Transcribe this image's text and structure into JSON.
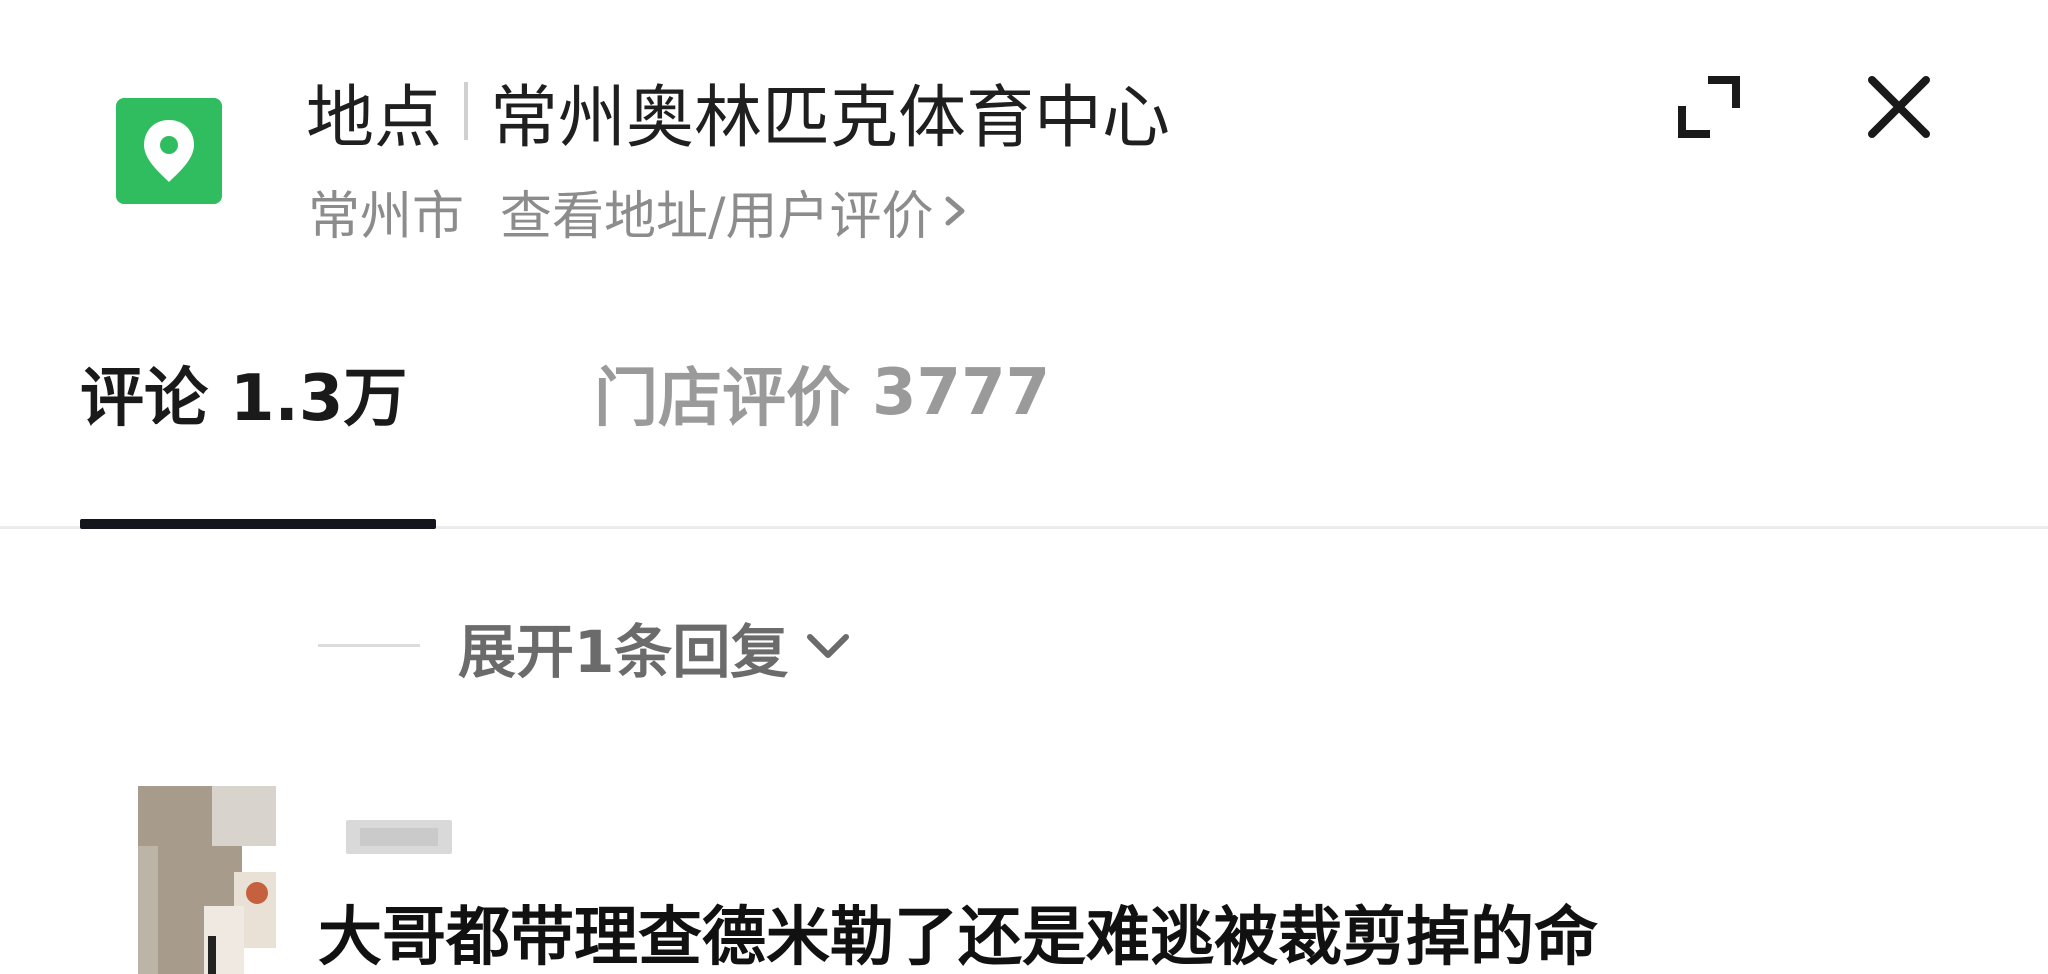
{
  "header": {
    "location_icon": "location-pin-icon",
    "title_prefix": "地点",
    "place_name": "常州奥林匹克体育中心",
    "city": "常州市",
    "detail_link": "查看地址/用户评价",
    "expand_icon": "expand-icon",
    "close_icon": "close-icon"
  },
  "tabs": [
    {
      "label": "评论",
      "count": "1.3万",
      "active": true
    },
    {
      "label": "门店评价",
      "count": "3777",
      "active": false
    }
  ],
  "replies": {
    "expand_label": "展开1条回复",
    "icon": "chevron-down-icon"
  },
  "comment": {
    "text": "大哥都带理查德米勒了还是难逃被裁剪掉的命"
  },
  "colors": {
    "accent_green": "#2fbd5f",
    "tab_active": "#1a1a1a",
    "tab_inactive": "#9a9a9a",
    "indicator": "#15161d"
  }
}
